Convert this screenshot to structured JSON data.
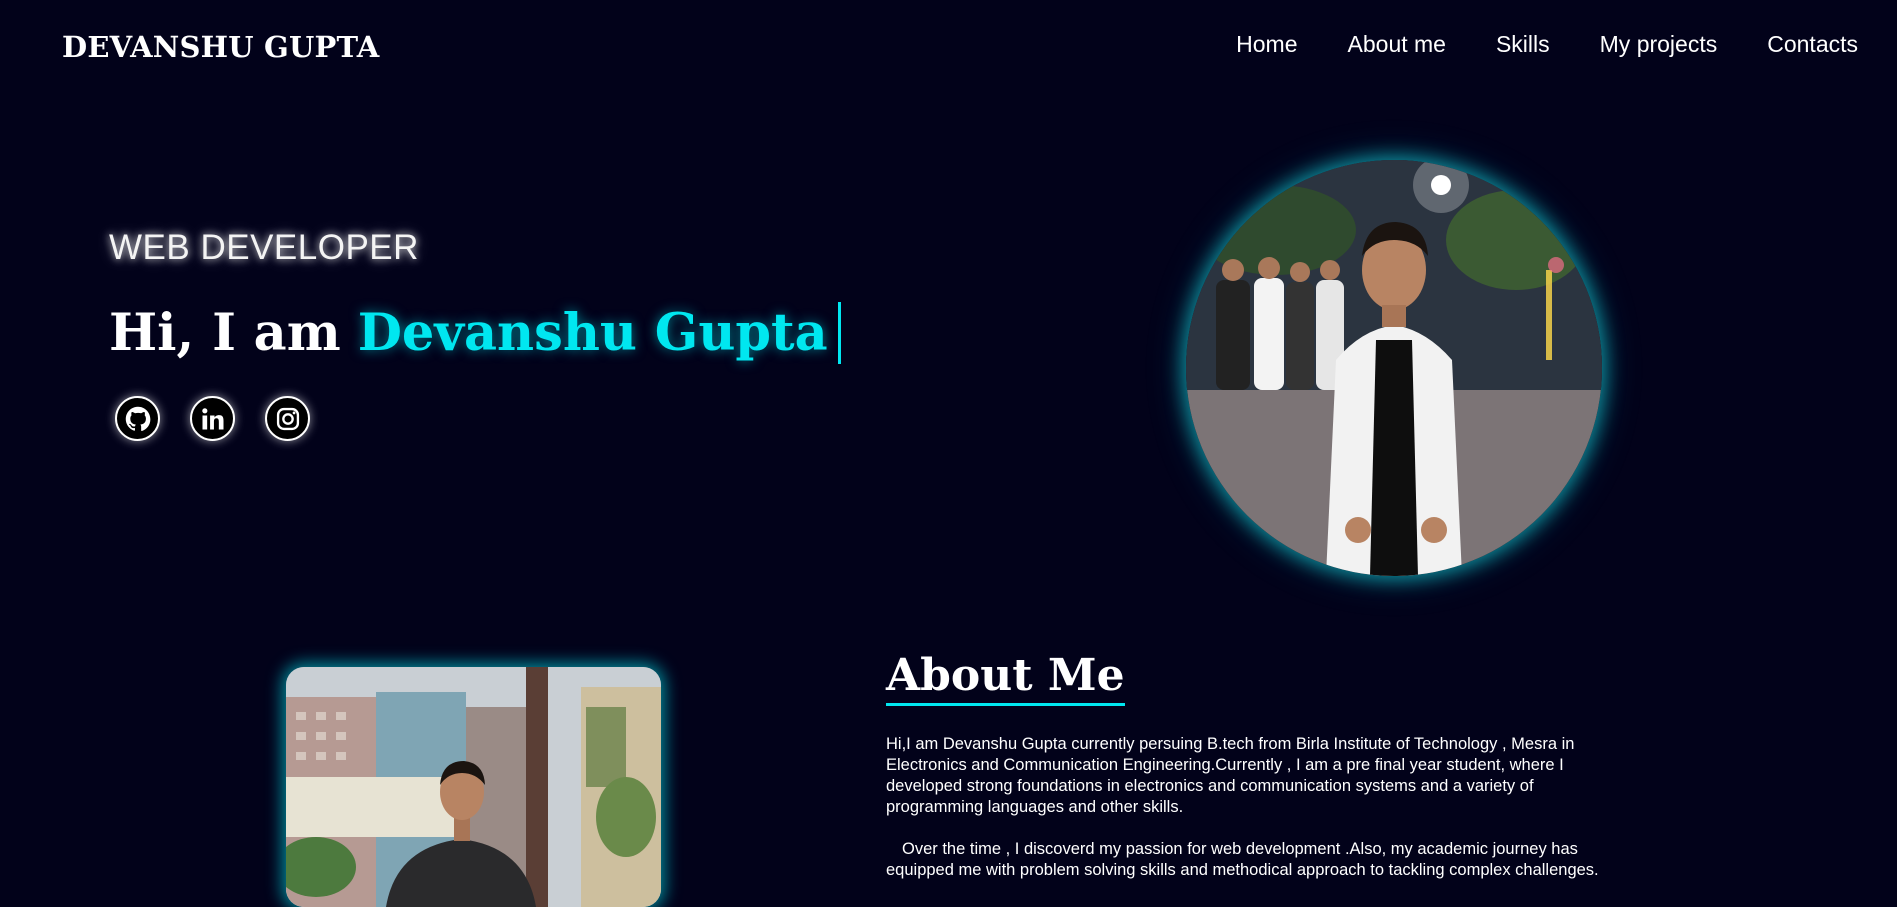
{
  "nav": {
    "brand": "DEVANSHU GUPTA",
    "links": [
      {
        "label": "Home"
      },
      {
        "label": "About me"
      },
      {
        "label": "Skills"
      },
      {
        "label": "My projects"
      },
      {
        "label": "Contacts"
      }
    ]
  },
  "hero": {
    "role": "WEB DEVELOPER",
    "greeting": "Hi, I am",
    "name": "Devanshu Gupta",
    "socials": [
      {
        "icon": "github-icon"
      },
      {
        "icon": "linkedin-icon"
      },
      {
        "icon": "instagram-icon"
      }
    ]
  },
  "about": {
    "title": "About Me",
    "paragraphs": [
      "Hi,I am Devanshu Gupta currently persuing B.tech from Birla Institute of Technology , Mesra in Electronics and Communication Engineering.Currently , I am a pre final year student, where I developed strong foundations in electronics and communication systems and a variety of programming languages and other skills.",
      "Over the time , I discoverd my passion for web development .Also, my academic journey has equipped me with problem solving skills and methodical approach to tackling complex challenges."
    ]
  },
  "colors": {
    "background": "#02021a",
    "accent": "#00e7f0",
    "text": "#ffffff"
  }
}
